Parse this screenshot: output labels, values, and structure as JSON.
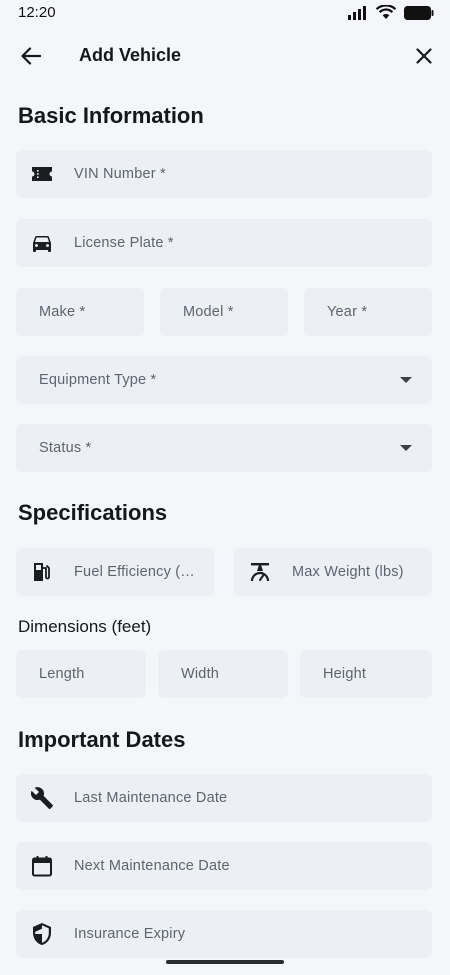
{
  "status_bar": {
    "time": "12:20"
  },
  "app_bar": {
    "title": "Add Vehicle"
  },
  "sections": {
    "basic": "Basic Information",
    "specs": "Specifications",
    "dimensions": "Dimensions (feet)",
    "dates": "Important Dates"
  },
  "fields": {
    "vin": "VIN Number *",
    "plate": "License Plate *",
    "make": "Make *",
    "model": "Model *",
    "year": "Year *",
    "equipment_type": "Equipment Type *",
    "status": "Status *",
    "fuel": "Fuel Efficiency (…",
    "max_weight": "Max Weight (lbs)",
    "length": "Length",
    "width": "Width",
    "height": "Height",
    "last_maintenance": "Last Maintenance Date",
    "next_maintenance": "Next Maintenance Date",
    "insurance": "Insurance Expiry"
  },
  "icons": {
    "back": "arrow-back-icon",
    "close": "close-icon",
    "vin": "ticket-icon",
    "plate": "car-icon",
    "fuel": "fuel-pump-icon",
    "weight": "scale-icon",
    "wrench": "wrench-icon",
    "calendar": "calendar-icon",
    "shield": "shield-icon"
  },
  "colors": {
    "background": "#f4f6f9",
    "field": "#eceff3",
    "text": "#15171a",
    "hint": "#5e6470"
  }
}
